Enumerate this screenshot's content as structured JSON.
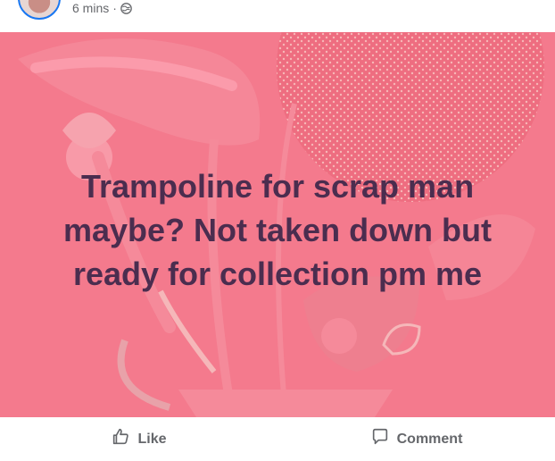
{
  "post": {
    "timestamp": "6 mins",
    "separator": "·",
    "audience_icon": "globe-icon",
    "text": "Trampoline for scrap man\nmaybe? Not taken down but\nready for collection pm me",
    "background_color": "#f47a8d",
    "text_color": "#4b2d4f"
  },
  "actions": {
    "like_label": "Like",
    "like_icon": "thumbs-up-icon",
    "comment_label": "Comment",
    "comment_icon": "comment-icon"
  }
}
